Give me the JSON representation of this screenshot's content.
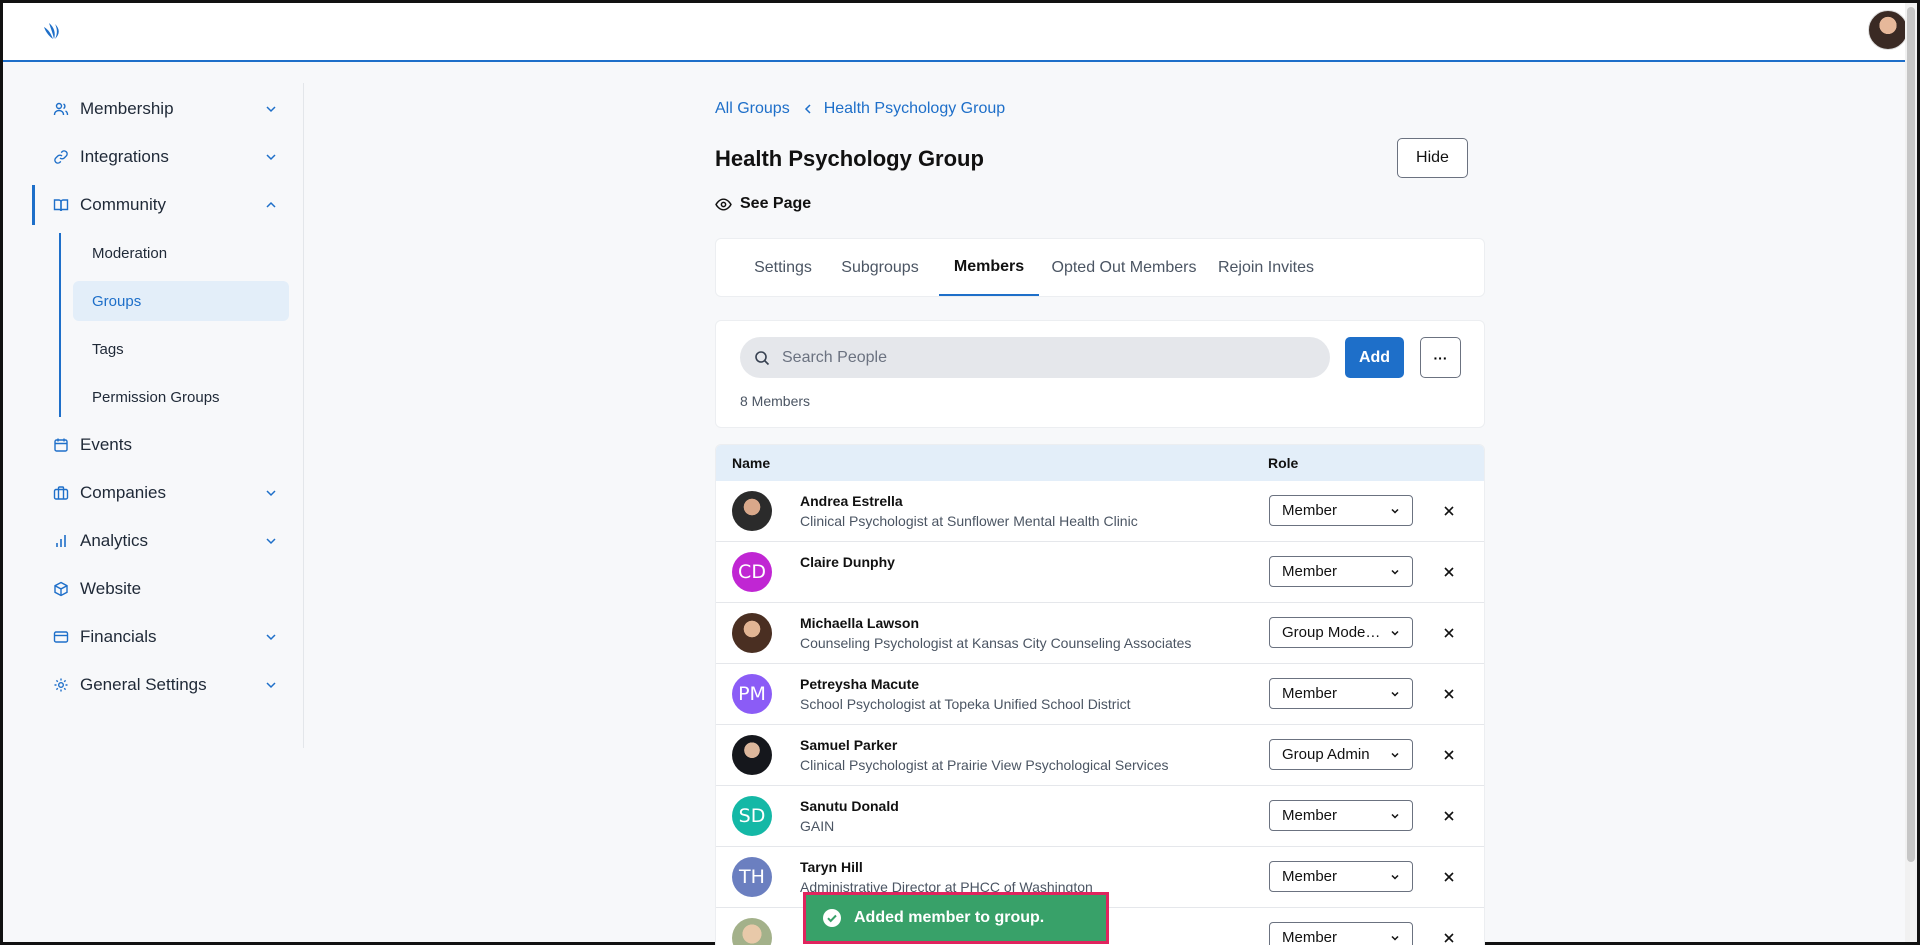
{
  "sidebar": {
    "items": [
      {
        "label": "Membership",
        "icon": "users-icon"
      },
      {
        "label": "Integrations",
        "icon": "link-icon"
      },
      {
        "label": "Community",
        "icon": "book-open-icon"
      },
      {
        "label": "Events",
        "icon": "calendar-icon"
      },
      {
        "label": "Companies",
        "icon": "briefcase-icon"
      },
      {
        "label": "Analytics",
        "icon": "bar-chart-icon"
      },
      {
        "label": "Website",
        "icon": "cube-icon"
      },
      {
        "label": "Financials",
        "icon": "credit-card-icon"
      },
      {
        "label": "General Settings",
        "icon": "gear-icon"
      }
    ],
    "community_sub": [
      "Moderation",
      "Groups",
      "Tags",
      "Permission Groups"
    ]
  },
  "breadcrumb": {
    "root": "All Groups",
    "current": "Health Psychology Group"
  },
  "page": {
    "title": "Health Psychology Group",
    "hide_label": "Hide",
    "see_page": "See Page"
  },
  "tabs": [
    "Settings",
    "Subgroups",
    "Members",
    "Opted Out Members",
    "Rejoin Invites"
  ],
  "search": {
    "placeholder": "Search People",
    "add_label": "Add",
    "more_label": "···",
    "count": "8 Members"
  },
  "table": {
    "headers": {
      "name": "Name",
      "role": "Role"
    },
    "rows": [
      {
        "name": "Andrea Estrella",
        "title": "Clinical Psychologist at Sunflower Mental Health Clinic",
        "role": "Member",
        "initials": ""
      },
      {
        "name": "Claire Dunphy",
        "title": "",
        "role": "Member",
        "initials": "CD"
      },
      {
        "name": "Michaella Lawson",
        "title": "Counseling Psychologist at Kansas City Counseling Associates",
        "role": "Group Moderator",
        "initials": ""
      },
      {
        "name": "Petreysha Macute",
        "title": "School Psychologist at Topeka Unified School District",
        "role": "Member",
        "initials": "PM"
      },
      {
        "name": "Samuel Parker",
        "title": "Clinical Psychologist at Prairie View Psychological Services",
        "role": "Group Admin",
        "initials": ""
      },
      {
        "name": "Sanutu Donald",
        "title": "GAIN",
        "role": "Member",
        "initials": "SD"
      },
      {
        "name": "Taryn Hill",
        "title": "Administrative Director at PHCC of Washington",
        "role": "Member",
        "initials": "TH"
      },
      {
        "name": "",
        "title": "",
        "role": "Member",
        "initials": ""
      }
    ]
  },
  "toast": {
    "message": "Added member to group."
  },
  "colors": {
    "accent": "#1e6fc9",
    "toast": "#38a169",
    "toast_border": "#e0245e"
  }
}
